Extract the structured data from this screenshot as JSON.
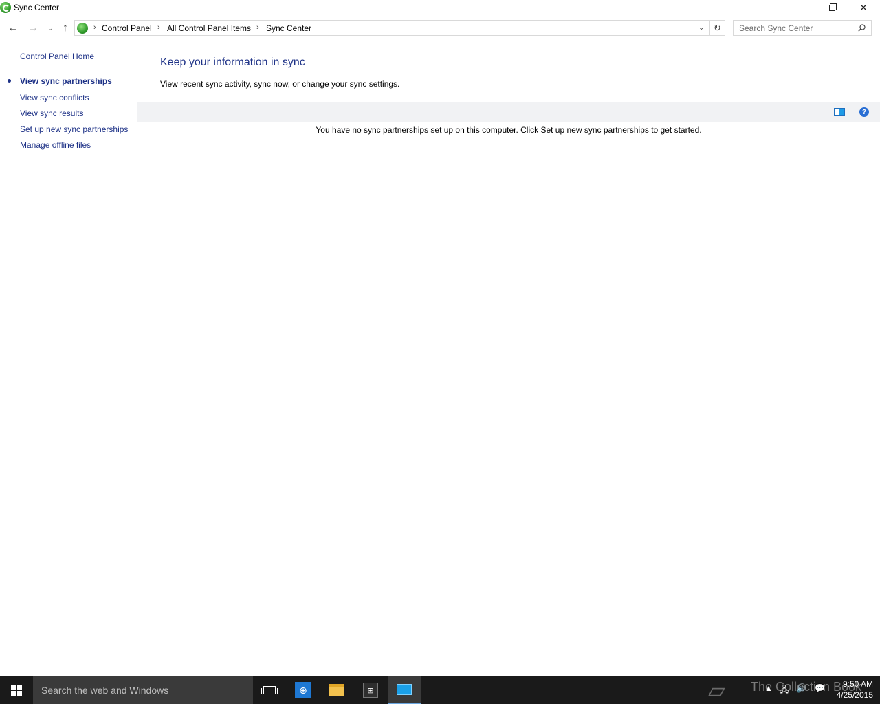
{
  "window": {
    "title": "Sync Center"
  },
  "nav": {
    "back_icon": "←",
    "forward_icon": "→",
    "recent_icon": "⌄",
    "up_icon": "↑",
    "breadcrumbs": [
      "Control Panel",
      "All Control Panel Items",
      "Sync Center"
    ],
    "separator": "›",
    "dropdown_icon": "⌄",
    "refresh_icon": "↻",
    "search_placeholder": "Search Sync Center"
  },
  "sidebar": {
    "home": "Control Panel Home",
    "items": [
      {
        "label": "View sync partnerships",
        "active": true
      },
      {
        "label": "View sync conflicts",
        "active": false
      },
      {
        "label": "View sync results",
        "active": false
      },
      {
        "label": "Set up new sync partnerships",
        "active": false
      },
      {
        "label": "Manage offline files",
        "active": false
      }
    ]
  },
  "main": {
    "title": "Keep your information in sync",
    "description": "View recent sync activity, sync now, or change your sync settings.",
    "help_label": "?",
    "empty_message": "You have no sync partnerships set up on this computer. Click Set up new sync partnerships to get started."
  },
  "taskbar": {
    "search_text": "Search the web and Windows",
    "watermark": "The Collection Book",
    "time": "9:50 AM",
    "date": "4/25/2015",
    "tray_up": "▲",
    "tray_network": "🖧",
    "tray_volume": "🔊",
    "tray_notifications": "💬"
  },
  "colors": {
    "link": "#1e3287",
    "taskbar": "#1a1a1a",
    "toolbar": "#f1f2f4"
  }
}
